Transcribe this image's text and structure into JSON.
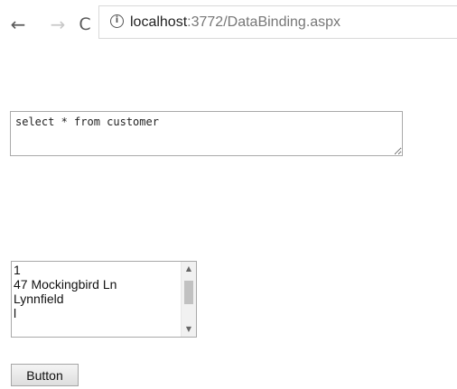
{
  "browser": {
    "url_host": "localhost",
    "url_rest": ":3772/DataBinding.aspx",
    "back_icon": "←",
    "forward_icon": "→",
    "reload_icon": "C",
    "info_icon": "i"
  },
  "form": {
    "sql_query": "select * from customer",
    "listbox_items": [
      "1",
      "47 Mockingbird Ln",
      "Lynnfield",
      "l"
    ],
    "button_label": "Button"
  },
  "icons": {
    "back": "arrow-left-icon",
    "forward": "arrow-right-icon",
    "reload": "reload-icon",
    "info": "info-icon",
    "scroll_up": "chevron-up-icon",
    "scroll_down": "chevron-down-icon"
  }
}
